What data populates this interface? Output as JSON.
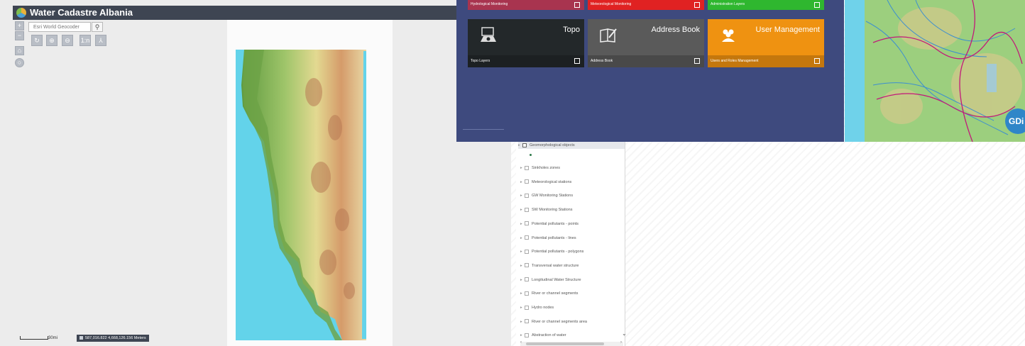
{
  "app": {
    "title": "Water Cadastre Albania",
    "geocoder_placeholder": "Esri World Geocoder",
    "zoom_in": "+",
    "zoom_out": "−",
    "tools": [
      "↻",
      "⊕",
      "⊖",
      "1:n",
      "⅄"
    ],
    "scale_label": "30mi",
    "coordinates": "587,016.822 4,668,126.156 Meters"
  },
  "dashboard": {
    "top_strip": [
      {
        "label": "Hydrological Monitoring",
        "color": "#a8344f"
      },
      {
        "label": "Meteorological Monitoring",
        "color": "#e02222"
      },
      {
        "label": "Administration Layers",
        "color": "#2fb72f"
      }
    ],
    "tiles": [
      {
        "title": "Topo",
        "footer": "Topo Layers",
        "color": "#23282a",
        "icon": "topo-map-icon"
      },
      {
        "title": "Address Book",
        "footer": "Address Book",
        "color": "#5a5a5a",
        "icon": "address-book-icon"
      },
      {
        "title": "User Management",
        "footer": "Users and Roles Management",
        "color": "#ef9211",
        "icon": "users-icon"
      }
    ],
    "badge": "GDi"
  },
  "layers": {
    "selected": "Geomorphological objects",
    "items": [
      "Sinkholes zones",
      "Meteorological stations",
      "GW Monitoring Stations",
      "SW Monitoring Stations",
      "Potential pollutants - points",
      "Potential pollutants - lines",
      "Potential pollutants - polygons",
      "Transversal water structure",
      "Longitudinal Water Structure",
      "River or channel segments",
      "Hydro nodes",
      "River or channel segments area",
      "Abstraction of water"
    ]
  }
}
